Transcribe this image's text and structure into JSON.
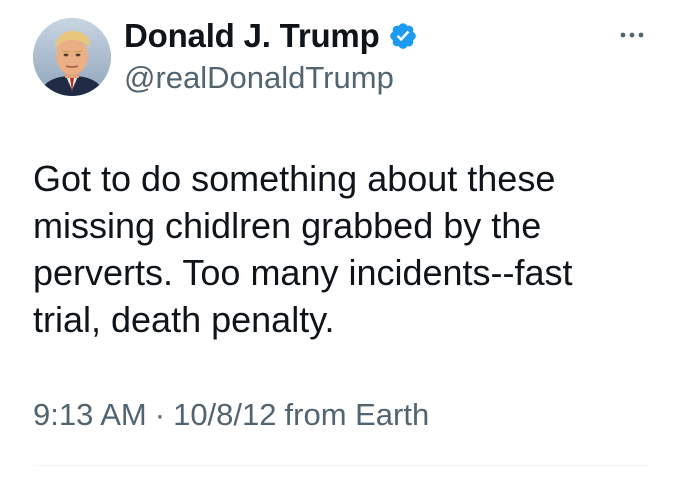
{
  "author": {
    "display_name": "Donald J. Trump",
    "handle": "@realDonaldTrump",
    "verified": true,
    "avatar_icon": "profile-photo",
    "verified_icon": "verified-badge-icon",
    "verified_color": "#1d9bf0"
  },
  "actions": {
    "more_icon": "more-options-icon"
  },
  "tweet": {
    "text_lines": [
      "Got to do something about these",
      "missing chidlren grabbed by the",
      "perverts. Too many incidents--fast",
      "trial, death penalty."
    ],
    "time": "9:13 AM",
    "separator": "·",
    "date": "10/8/12",
    "source": "from Earth"
  },
  "colors": {
    "text_primary": "#0f1419",
    "text_secondary": "#536471",
    "divider": "#eff3f4"
  }
}
